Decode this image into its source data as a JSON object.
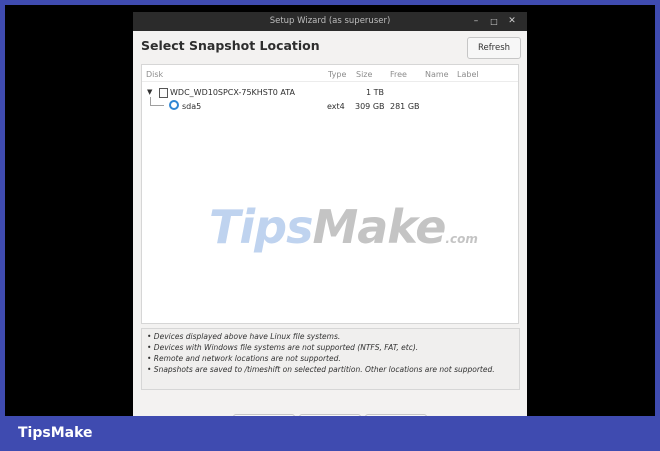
{
  "window": {
    "title": "Setup Wizard (as superuser)",
    "controls": {
      "minimize": "–",
      "maximize": "□",
      "close": "✕"
    }
  },
  "heading": "Select Snapshot Location",
  "refresh_label": "Refresh",
  "table": {
    "columns": [
      "Disk",
      "Type",
      "Size",
      "Free",
      "Name",
      "Label"
    ],
    "disk": {
      "expander": "▼",
      "name": "WDC_WD10SPCX-75KHST0 ATA",
      "size": "1 TB"
    },
    "partition": {
      "name": "sda5",
      "type": "ext4",
      "size": "309 GB",
      "free": "281 GB",
      "selected": true
    }
  },
  "notes": [
    "• Devices displayed above have Linux file systems.",
    "• Devices with Windows file systems are not supported (NTFS, FAT, etc).",
    "• Remote and network locations are not supported.",
    "• Snapshots are saved to /timeshift on selected partition. Other locations are not supported."
  ],
  "watermark": {
    "tips": "Tips",
    "make": "Make",
    "com": ".com"
  },
  "brand": "TipsMake",
  "colors": {
    "frame": "#3f4bb0",
    "accent": "#2f86d3",
    "titlebar": "#2b2b2b"
  }
}
